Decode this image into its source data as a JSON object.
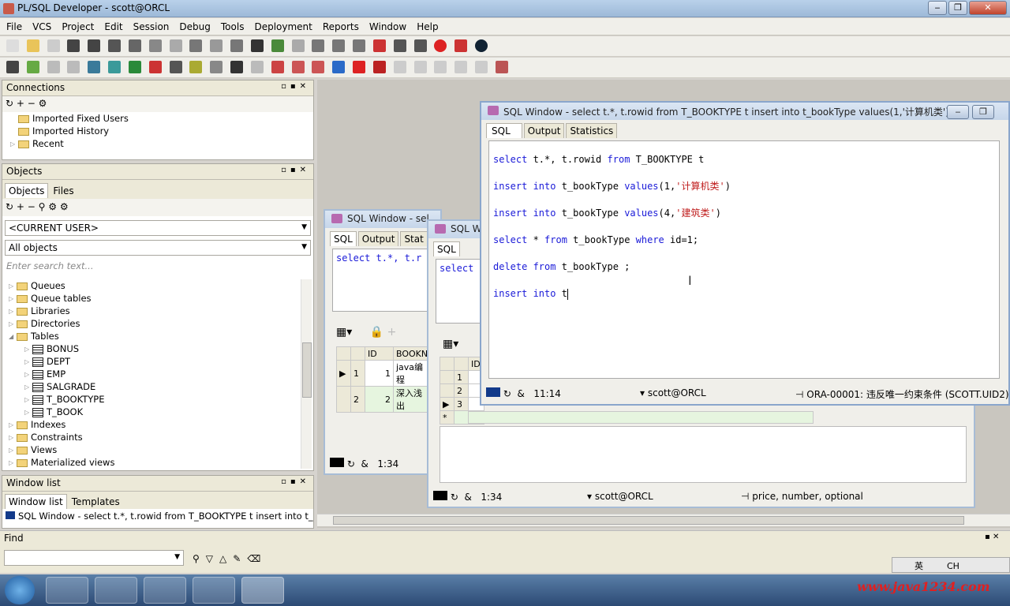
{
  "app": {
    "title": "PL/SQL Developer - scott@ORCL"
  },
  "menu": [
    "File",
    "VCS",
    "Project",
    "Edit",
    "Session",
    "Debug",
    "Tools",
    "Deployment",
    "Reports",
    "Window",
    "Help"
  ],
  "connections": {
    "title": "Connections",
    "items": [
      "Imported Fixed Users",
      "Imported History",
      "Recent"
    ]
  },
  "objects": {
    "title": "Objects",
    "tabs": [
      "Objects",
      "Files"
    ],
    "user_select": "<CURRENT USER>",
    "filter_select": "All objects",
    "search_placeholder": "Enter search text...",
    "tree": [
      {
        "label": "Queues",
        "kind": "folder",
        "level": 0
      },
      {
        "label": "Queue tables",
        "kind": "folder",
        "level": 0
      },
      {
        "label": "Libraries",
        "kind": "folder",
        "level": 0
      },
      {
        "label": "Directories",
        "kind": "folder",
        "level": 0
      },
      {
        "label": "Tables",
        "kind": "folder-open",
        "level": 0
      },
      {
        "label": "BONUS",
        "kind": "table",
        "level": 1
      },
      {
        "label": "DEPT",
        "kind": "table",
        "level": 1
      },
      {
        "label": "EMP",
        "kind": "table",
        "level": 1
      },
      {
        "label": "SALGRADE",
        "kind": "table",
        "level": 1
      },
      {
        "label": "T_BOOKTYPE",
        "kind": "table",
        "level": 1
      },
      {
        "label": "T_BOOK",
        "kind": "table",
        "level": 1
      },
      {
        "label": "Indexes",
        "kind": "folder",
        "level": 0
      },
      {
        "label": "Constraints",
        "kind": "folder",
        "level": 0
      },
      {
        "label": "Views",
        "kind": "folder",
        "level": 0
      },
      {
        "label": "Materialized views",
        "kind": "folder",
        "level": 0
      }
    ]
  },
  "windowlist": {
    "title": "Window list",
    "tabs": [
      "Window list",
      "Templates"
    ],
    "item": "SQL Window - select t.*, t.rowid from T_BOOKTYPE t insert into t_bo"
  },
  "find": {
    "label": "Find"
  },
  "win1": {
    "title": "SQL Window - sel",
    "tabs": [
      "SQL",
      "Output",
      "Stat"
    ],
    "code": "select t.*, t.r",
    "grid_headers": [
      "ID",
      "BOOKN"
    ],
    "rows": [
      [
        "1",
        "1",
        "java编程"
      ],
      [
        "2",
        "2",
        "深入浅出"
      ]
    ],
    "pos": "1:34"
  },
  "win2": {
    "title": "SQL W",
    "tabs": [
      "SQL"
    ],
    "code": "select",
    "grid_header": "ID",
    "rownums": [
      "1",
      "2",
      "3"
    ],
    "pos": "1:34",
    "conn": "scott@ORCL",
    "hint": "price, number, optional"
  },
  "win3": {
    "title": "SQL Window - select t.*, t.rowid from T_BOOKTYPE t insert into t_bookType values(1,'计算机类')...",
    "tabs": [
      "SQL",
      "Output",
      "Statistics"
    ],
    "lines": [
      {
        "kw1": "select",
        "rest": " t.*, t.rowid ",
        "kw2": "from",
        "rest2": " T_BOOKTYPE t"
      },
      {
        "kw1": "insert into",
        "rest": " t_bookType ",
        "kw2": "values",
        "rest2": "(1,",
        "str": "'计算机类'",
        "end": ")"
      },
      {
        "kw1": "insert into",
        "rest": " t_bookType ",
        "kw2": "values",
        "rest2": "(4,",
        "str": "'建筑类'",
        "end": ")"
      },
      {
        "kw1": "select",
        "rest": " * ",
        "kw2": "from",
        "rest2": " t_bookType ",
        "kw3": "where",
        "rest3": " id=1;"
      },
      {
        "kw1": "delete from",
        "rest": " t_bookType ;"
      },
      {
        "kw1": "insert into",
        "rest": " t"
      }
    ],
    "pos": "11:14",
    "conn": "scott@ORCL",
    "error": "ORA-00001: 违反唯一约束条件 (SCOTT.UID2)"
  },
  "tray": {
    "ime": "英",
    "lang": "CH"
  },
  "watermark": "www.java1234.com",
  "colors": {
    "keyword": "#1a1ad8",
    "string": "#c02020",
    "title_bg": "#b9d1ea"
  }
}
